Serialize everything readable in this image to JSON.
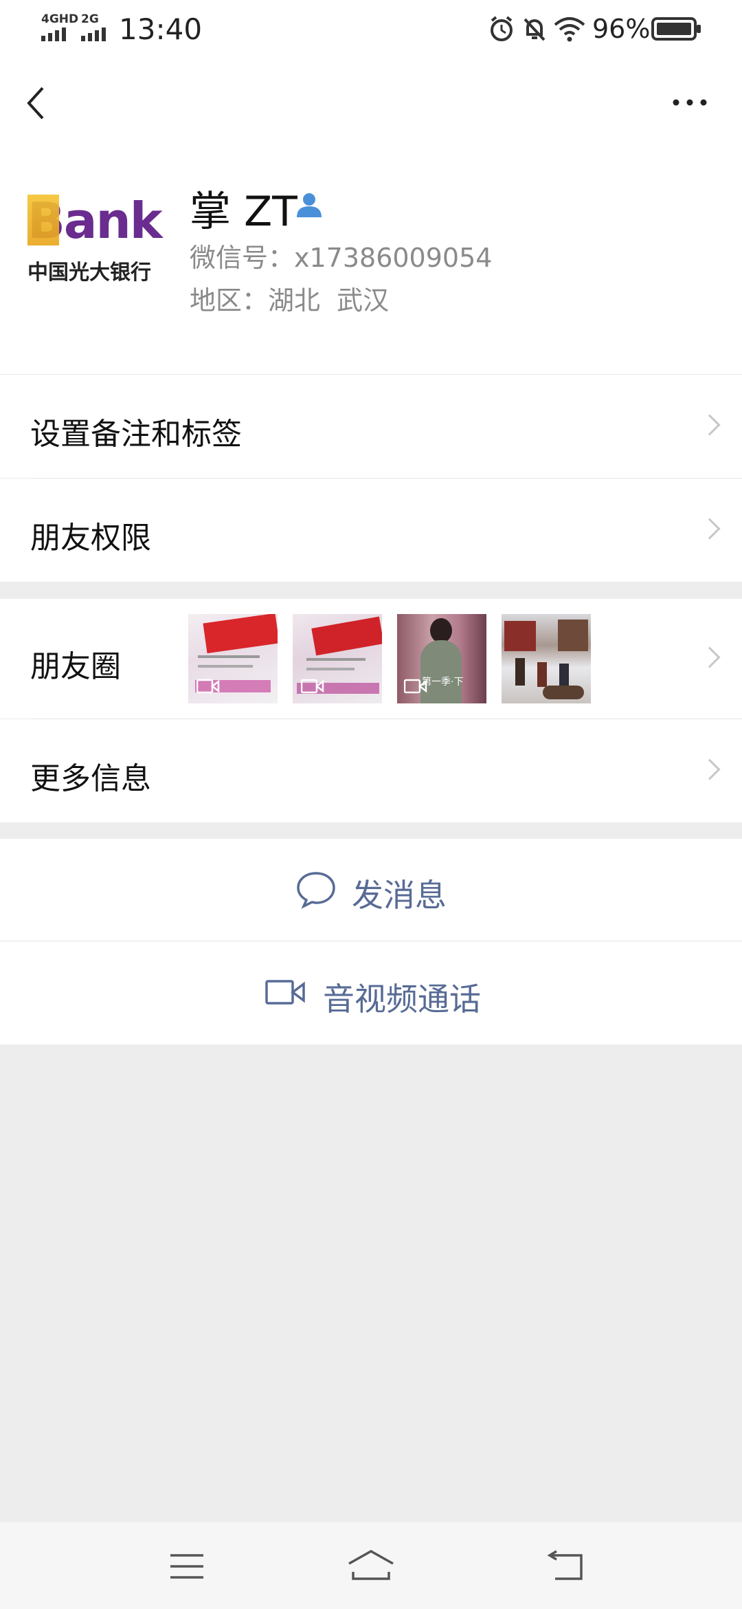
{
  "status_bar": {
    "network1": "4GHD",
    "network2": "2G",
    "time": "13:40",
    "battery": "96%",
    "icons": [
      "alarm-icon",
      "bell-muted-icon",
      "wifi-icon",
      "battery-icon"
    ]
  },
  "nav": {
    "back_icon": "chevron-left-icon",
    "more_icon": "more-dots-icon"
  },
  "profile": {
    "avatar_logo_text": "Bank",
    "avatar_logo_sub": "中国光大银行",
    "name": "掌 ZT",
    "wechat_id": "微信号：x17386009054",
    "region": "地区：湖北  武汉"
  },
  "rows": {
    "remark": "设置备注和标签",
    "permissions": "朋友权限",
    "moments": "朋友圈",
    "more_info": "更多信息"
  },
  "moments_thumbs": [
    {
      "type": "video",
      "desc": "pink form photo"
    },
    {
      "type": "video",
      "desc": "pink form photo"
    },
    {
      "type": "video",
      "caption": "第一季·下"
    },
    {
      "type": "image",
      "desc": "snowy street painting"
    }
  ],
  "actions": {
    "message": "发消息",
    "call": "音视频通话"
  },
  "colors": {
    "link": "#576b95",
    "background": "#ededed",
    "verified": "#4a90d9"
  }
}
